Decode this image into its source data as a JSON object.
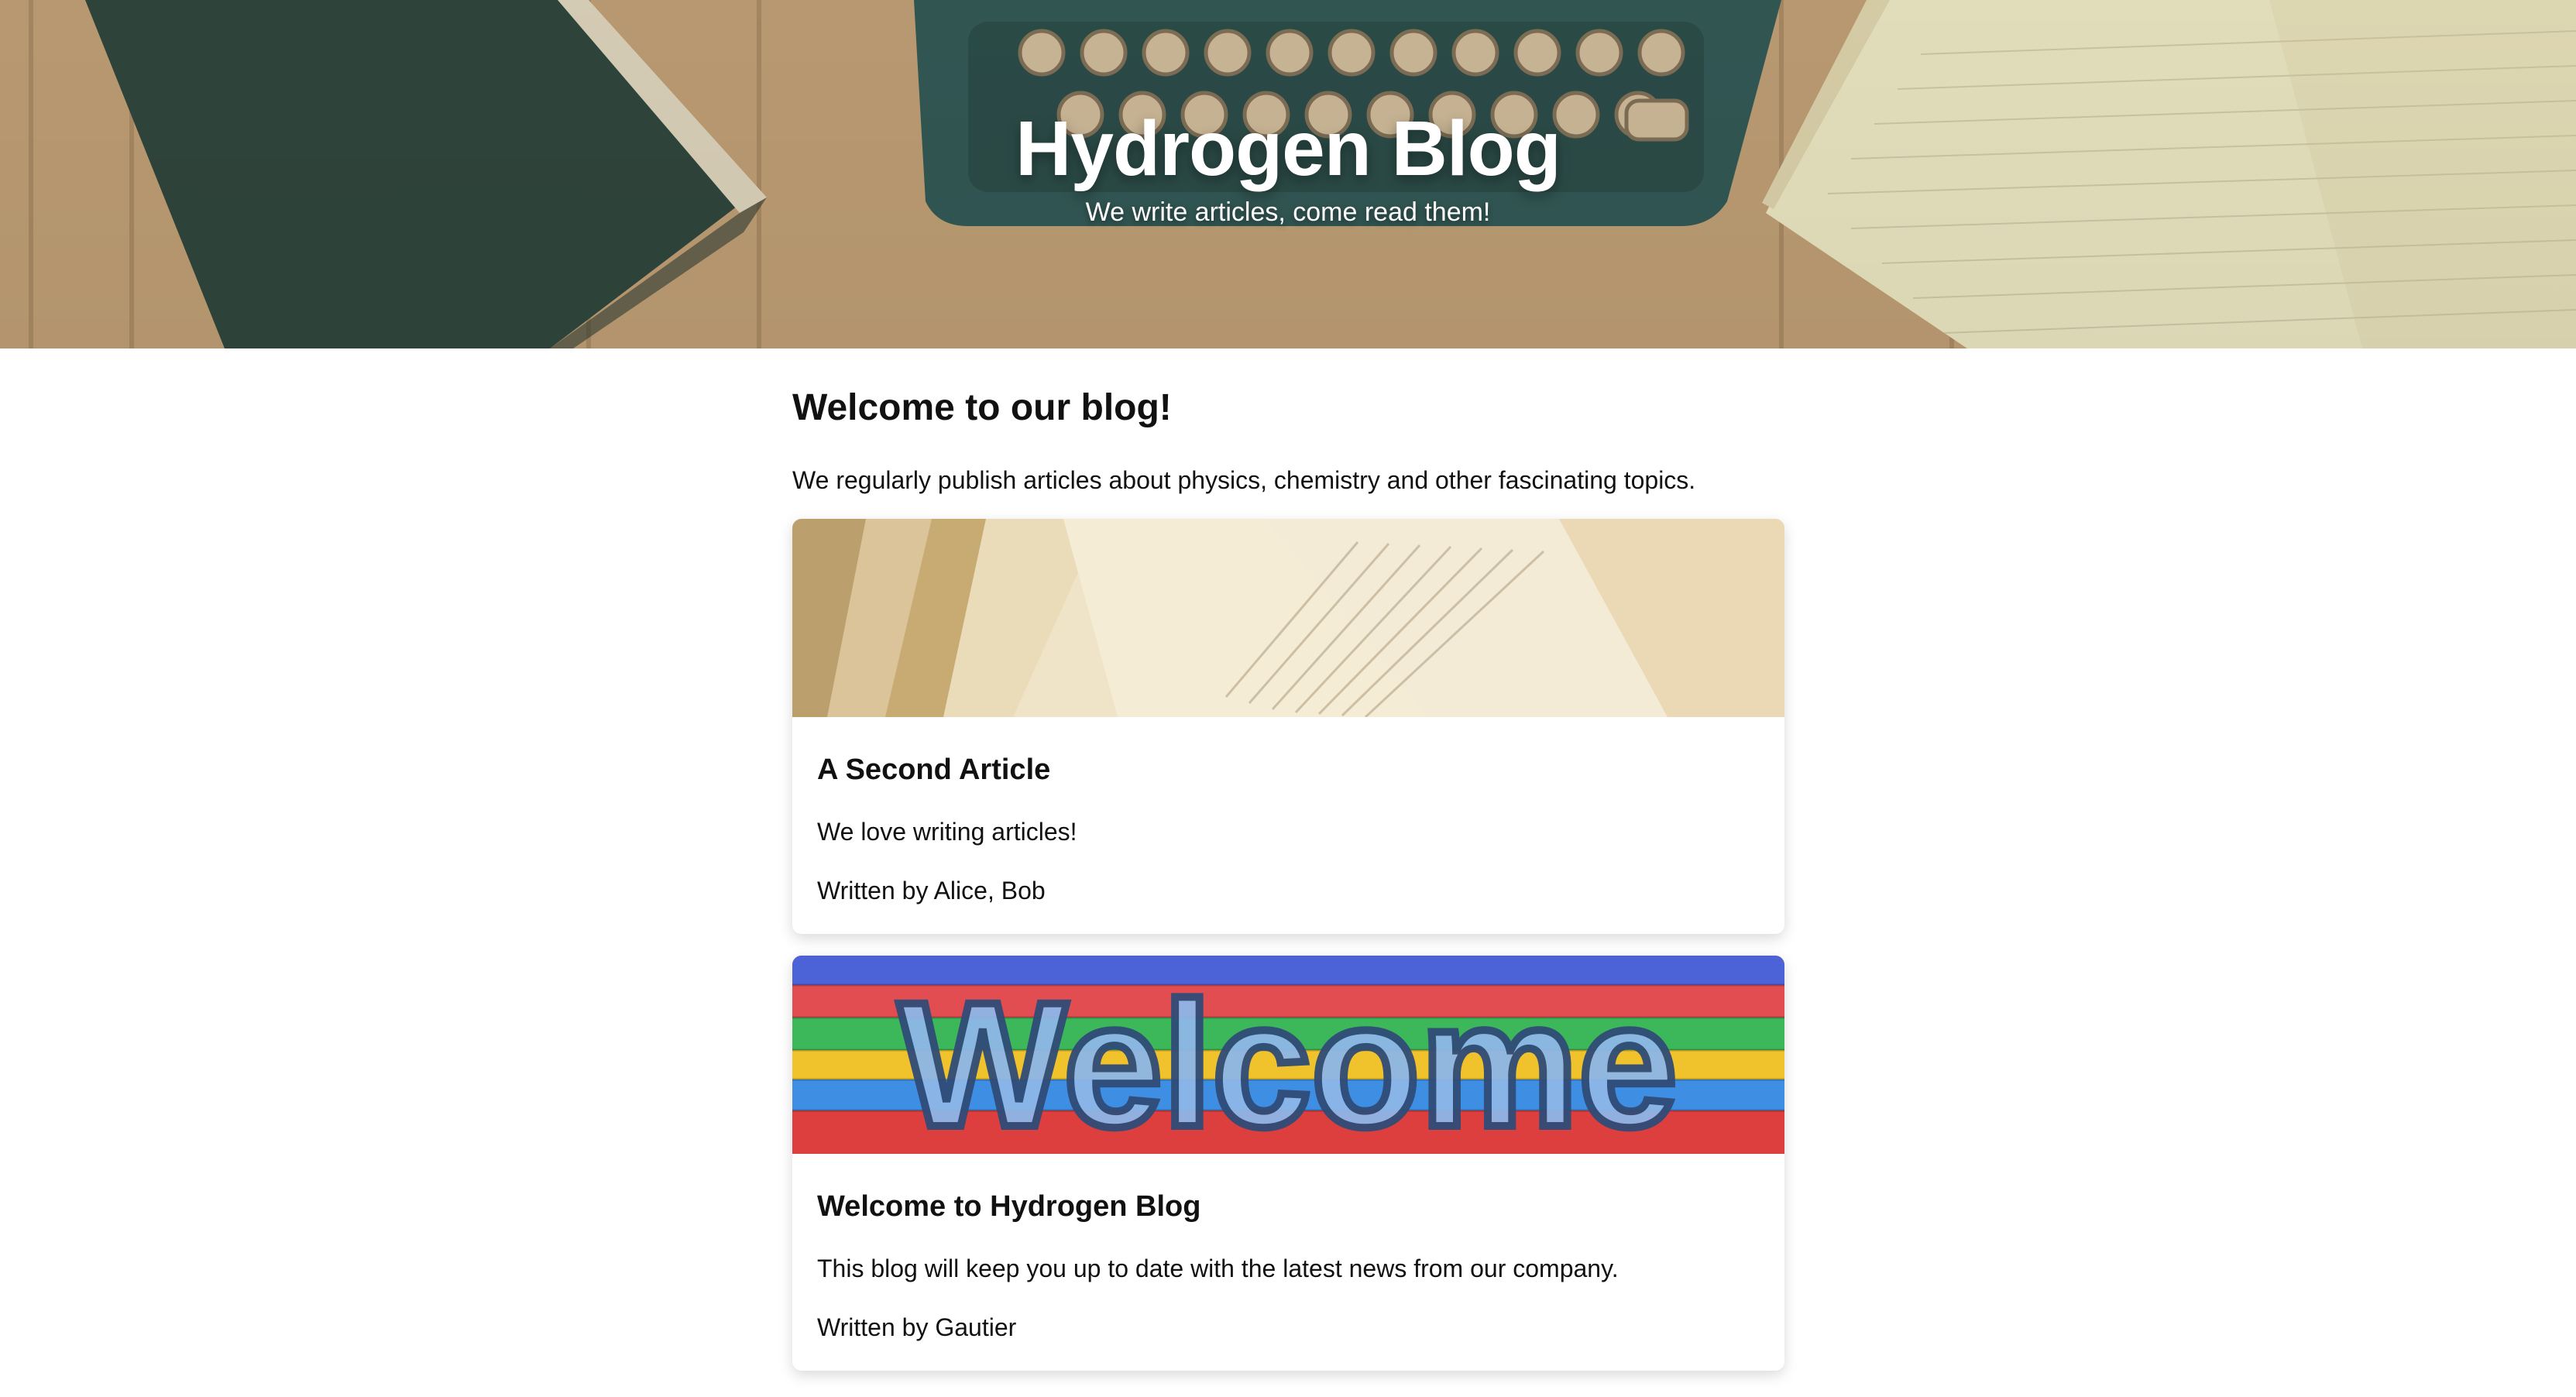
{
  "hero": {
    "title": "Hydrogen Blog",
    "subtitle": "We write articles, come read them!"
  },
  "intro": {
    "heading": "Welcome to our blog!",
    "text": "We regularly publish articles about physics, chemistry and other fascinating topics."
  },
  "articles": [
    {
      "title": "A Second Article",
      "summary": "We love writing articles!",
      "byline": "Written by Alice, Bob"
    },
    {
      "title": "Welcome to Hydrogen Blog",
      "summary": "This blog will keep you up to date with the latest news from our company.",
      "byline": "Written by Gautier",
      "image_text": "Welcome"
    }
  ]
}
